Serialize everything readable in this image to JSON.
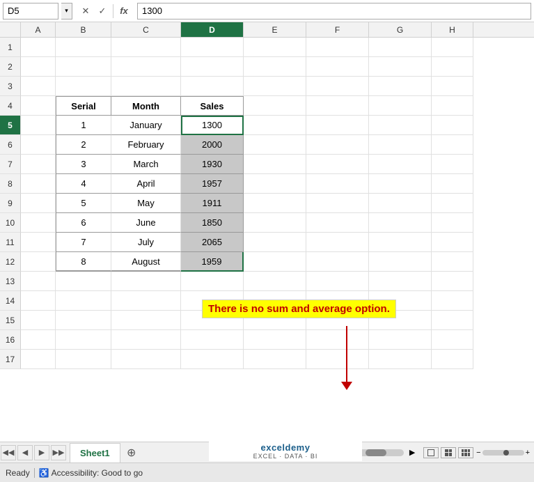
{
  "formulaBar": {
    "cellRef": "D5",
    "formulaValue": "1300",
    "crossIcon": "✕",
    "checkIcon": "✓",
    "fxLabel": "fx"
  },
  "columns": [
    {
      "id": "row-num",
      "label": "",
      "width": "row-num"
    },
    {
      "id": "A",
      "label": "A",
      "width": "w-a"
    },
    {
      "id": "B",
      "label": "B",
      "width": "w-b"
    },
    {
      "id": "C",
      "label": "C",
      "width": "w-c"
    },
    {
      "id": "D",
      "label": "D",
      "width": "w-d",
      "active": true
    },
    {
      "id": "E",
      "label": "E",
      "width": "w-e"
    },
    {
      "id": "F",
      "label": "F",
      "width": "w-f"
    },
    {
      "id": "G",
      "label": "G",
      "width": "w-g"
    },
    {
      "id": "H",
      "label": "H",
      "width": "w-h"
    }
  ],
  "tableHeaders": {
    "serial": "Serial",
    "month": "Month",
    "sales": "Sales"
  },
  "tableData": [
    {
      "serial": "1",
      "month": "January",
      "sales": "1300",
      "salesShaded": false
    },
    {
      "serial": "2",
      "month": "February",
      "sales": "2000",
      "salesShaded": true
    },
    {
      "serial": "3",
      "month": "March",
      "sales": "1930",
      "salesShaded": true
    },
    {
      "serial": "4",
      "month": "April",
      "sales": "1957",
      "salesShaded": true
    },
    {
      "serial": "5",
      "month": "May",
      "sales": "1911",
      "salesShaded": true
    },
    {
      "serial": "6",
      "month": "June",
      "sales": "1850",
      "salesShaded": true
    },
    {
      "serial": "7",
      "month": "July",
      "sales": "2065",
      "salesShaded": true
    },
    {
      "serial": "8",
      "month": "August",
      "sales": "1959",
      "salesShaded": true
    }
  ],
  "rows": [
    1,
    2,
    3,
    4,
    5,
    6,
    7,
    8,
    9,
    10,
    11,
    12,
    13,
    14,
    15,
    16,
    17
  ],
  "annotation": {
    "text": "There is no sum and average option."
  },
  "sheetTab": {
    "name": "Sheet1"
  },
  "statusBar": {
    "ready": "Ready",
    "accessibility": "Accessibility: Good to go"
  },
  "excelDemy": {
    "brand": "exceldemy",
    "sub": "EXCEL · DATA · BI"
  }
}
